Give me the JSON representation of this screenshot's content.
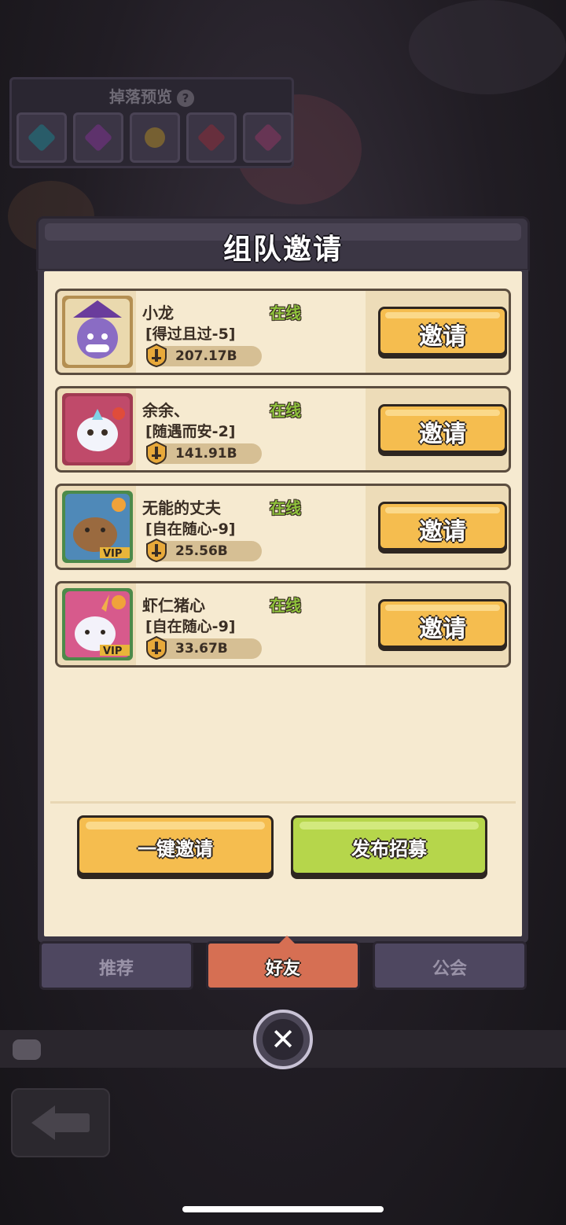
{
  "background": {
    "drop_preview_title": "掉落预览",
    "drop_help_icon": "?",
    "drop_items": [
      {
        "icon": "cyan-gem-icon",
        "color": "#1b7b87"
      },
      {
        "icon": "purple-gem-icon",
        "color": "#7b2f8c"
      },
      {
        "icon": "gold-coin-icon",
        "color": "#a88322"
      },
      {
        "icon": "red-star-icon",
        "color": "#8c2a36"
      },
      {
        "icon": "pink-star-icon",
        "color": "#8c3560"
      }
    ]
  },
  "dialog": {
    "title": "组队邀请",
    "friends": [
      {
        "name": "小龙",
        "guild": "[得过且过-5]",
        "status": "在线",
        "power": "207.17B",
        "invite": "邀请",
        "avatar": "purple-wizard-avatar-icon",
        "avatar_color": "#8a6cc4",
        "frame_color": "#b48f52",
        "vip": false
      },
      {
        "name": "余余、",
        "guild": "[随遇而安-2]",
        "status": "在线",
        "power": "141.91B",
        "invite": "邀请",
        "avatar": "white-dragon-avatar-icon",
        "avatar_color": "#c04a6a",
        "frame_color": "#a13a52",
        "vip": false
      },
      {
        "name": "无能的丈夫",
        "guild": "[自在随心-9]",
        "status": "在线",
        "power": "25.56B",
        "invite": "邀请",
        "avatar": "capybara-avatar-icon",
        "avatar_color": "#4f89b8",
        "frame_color": "#4c8a4a",
        "vip": true
      },
      {
        "name": "虾仁猪心",
        "guild": "[自在随心-9]",
        "status": "在线",
        "power": "33.67B",
        "invite": "邀请",
        "avatar": "unicorn-avatar-icon",
        "avatar_color": "#d75a8c",
        "frame_color": "#4c8a4a",
        "vip": true
      }
    ],
    "vip_label": "VIP",
    "invite_all": "一键邀请",
    "post_recruit": "发布招募",
    "tabs": [
      {
        "label": "推荐",
        "active": false
      },
      {
        "label": "好友",
        "active": true
      },
      {
        "label": "公会",
        "active": false
      }
    ]
  },
  "colors": {
    "online_green": "#8fc23c",
    "invite_orange": "#f5bd4f",
    "recruit_green": "#b6d64b",
    "active_tab": "#d66f53",
    "inactive_tab": "#4e4760"
  }
}
